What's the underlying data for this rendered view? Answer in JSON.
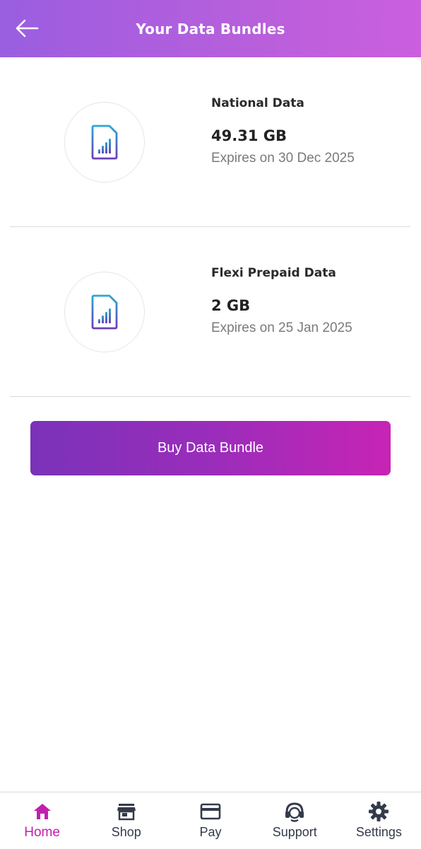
{
  "header": {
    "title": "Your Data Bundles"
  },
  "bundles": [
    {
      "name": "National Data",
      "amount": "49.31 GB",
      "expiry": "Expires on 30 Dec 2025",
      "icon": "sim-card-signal-icon"
    },
    {
      "name": "Flexi Prepaid Data",
      "amount": "2 GB",
      "expiry": "Expires on 25 Jan 2025",
      "icon": "sim-card-signal-icon"
    }
  ],
  "buy_button": {
    "label": "Buy Data Bundle"
  },
  "nav": {
    "items": [
      {
        "label": "Home",
        "icon": "home-icon",
        "active": true
      },
      {
        "label": "Shop",
        "icon": "store-icon",
        "active": false
      },
      {
        "label": "Pay",
        "icon": "credit-card-icon",
        "active": false
      },
      {
        "label": "Support",
        "icon": "headset-icon",
        "active": false
      },
      {
        "label": "Settings",
        "icon": "gear-icon",
        "active": false
      }
    ]
  },
  "colors": {
    "header_gradient_start": "#9a5ee0",
    "header_gradient_end": "#cb5fde",
    "button_gradient_start": "#7a32b9",
    "button_gradient_end": "#c724b4",
    "active_nav": "#c21fae",
    "inactive_nav": "#333a4a"
  }
}
